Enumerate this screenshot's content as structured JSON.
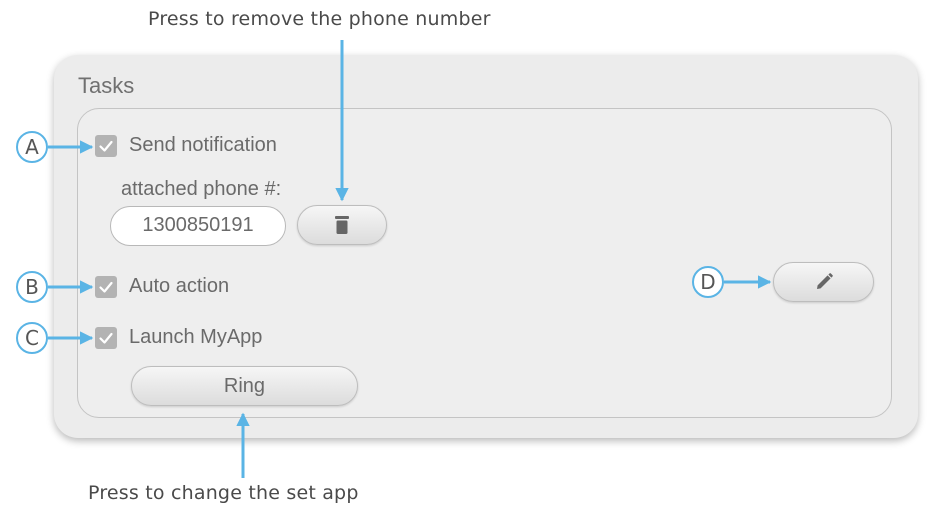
{
  "captions": {
    "top": "Press to remove the phone number",
    "bottom": "Press to change the set app"
  },
  "panel": {
    "title": "Tasks"
  },
  "tasks": {
    "send_notification": {
      "label": "Send notification",
      "checked": true
    },
    "phone_label": "attached phone #:",
    "phone_value": "1300850191",
    "auto_action": {
      "label": "Auto action",
      "checked": true
    },
    "launch_app": {
      "label": "Launch MyApp",
      "checked": true
    },
    "app_button_label": "Ring"
  },
  "markers": {
    "a": "A",
    "b": "B",
    "c": "C",
    "d": "D"
  },
  "icons": {
    "delete": "trash-icon",
    "edit": "pencil-icon",
    "check": "checkmark-icon"
  },
  "colors": {
    "arrow": "#5ab4e5",
    "panel": "#ececec",
    "checkbox": "#b3b3b3"
  }
}
